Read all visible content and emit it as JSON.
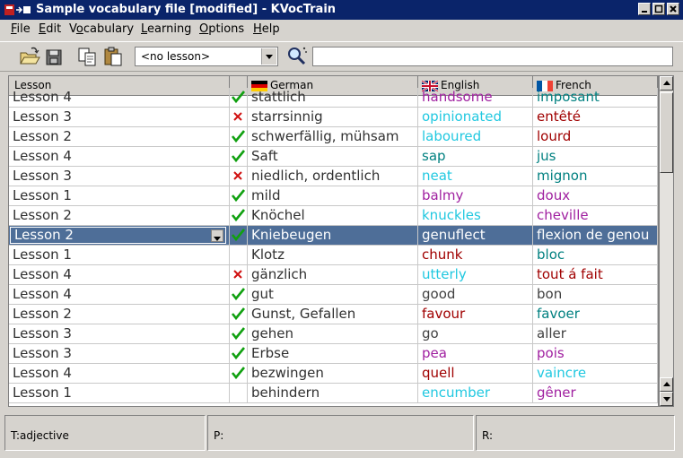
{
  "window": {
    "title": "Sample vocabulary file [modified] - KVocTrain"
  },
  "menu": [
    "File",
    "Edit",
    "Vocabulary",
    "Learning",
    "Options",
    "Help"
  ],
  "menu_mnemonic": [
    "F",
    "E",
    "o",
    "L",
    "O",
    "H"
  ],
  "toolbar": {
    "lesson_select": "<no lesson>",
    "search_value": ""
  },
  "table": {
    "headers": {
      "lesson": "Lesson",
      "german": "German",
      "english": "English",
      "french": "French"
    },
    "rows": [
      {
        "lesson": "Lesson 4",
        "mark": "check",
        "german": "stattlich",
        "english": "handsome",
        "french": "imposant",
        "ec": "#a020a0",
        "fc": "#008080"
      },
      {
        "lesson": "Lesson 3",
        "mark": "cross",
        "german": "starrsinnig",
        "english": "opinionated",
        "french": "entêté",
        "ec": "#20c8e0",
        "fc": "#a00000"
      },
      {
        "lesson": "Lesson 2",
        "mark": "check",
        "german": "schwerfällig, mühsam",
        "english": "laboured",
        "french": "lourd",
        "ec": "#20c8e0",
        "fc": "#a00000"
      },
      {
        "lesson": "Lesson 4",
        "mark": "check",
        "german": "Saft",
        "english": "sap",
        "french": "jus",
        "ec": "#008080",
        "fc": "#008080"
      },
      {
        "lesson": "Lesson 3",
        "mark": "cross",
        "german": "niedlich, ordentlich",
        "english": "neat",
        "french": "mignon",
        "ec": "#20c8e0",
        "fc": "#008080"
      },
      {
        "lesson": "Lesson 1",
        "mark": "check",
        "german": "mild",
        "english": "balmy",
        "french": "doux",
        "ec": "#a020a0",
        "fc": "#a020a0"
      },
      {
        "lesson": "Lesson 2",
        "mark": "check",
        "german": "Knöchel",
        "english": "knuckles",
        "french": "cheville",
        "ec": "#20c8e0",
        "fc": "#a020a0"
      },
      {
        "lesson": "Lesson 2",
        "mark": "check",
        "german": "Kniebeugen",
        "english": "genuflect",
        "french": "flexion de genou",
        "ec": "#ffffff",
        "fc": "#ffffff",
        "selected": true
      },
      {
        "lesson": "Lesson 1",
        "mark": "",
        "german": "Klotz",
        "english": "chunk",
        "french": "bloc",
        "ec": "#a00000",
        "fc": "#008080"
      },
      {
        "lesson": "Lesson 4",
        "mark": "cross",
        "german": "gänzlich",
        "english": "utterly",
        "french": "tout á fait",
        "ec": "#20c8e0",
        "fc": "#a00000"
      },
      {
        "lesson": "Lesson 4",
        "mark": "check",
        "german": "gut",
        "english": "good",
        "french": "bon",
        "ec": "#404040",
        "fc": "#404040"
      },
      {
        "lesson": "Lesson 2",
        "mark": "check",
        "german": "Gunst, Gefallen",
        "english": "favour",
        "french": "favoer",
        "ec": "#a00000",
        "fc": "#008080"
      },
      {
        "lesson": "Lesson 3",
        "mark": "check",
        "german": "gehen",
        "english": "go",
        "french": "aller",
        "ec": "#404040",
        "fc": "#404040"
      },
      {
        "lesson": "Lesson 3",
        "mark": "check",
        "german": "Erbse",
        "english": "pea",
        "french": "pois",
        "ec": "#a020a0",
        "fc": "#a020a0"
      },
      {
        "lesson": "Lesson 4",
        "mark": "check",
        "german": "bezwingen",
        "english": "quell",
        "french": "vaincre",
        "ec": "#a00000",
        "fc": "#20c8e0"
      },
      {
        "lesson": "Lesson 1",
        "mark": "",
        "german": "behindern",
        "english": "encumber",
        "french": "gêner",
        "ec": "#20c8e0",
        "fc": "#a020a0"
      }
    ]
  },
  "status": {
    "type": "T:adjective",
    "pron": "P:",
    "remark": "R:"
  },
  "icons": {
    "open": "folder-open-icon",
    "save": "save-disk-icon",
    "copy": "copy-icon",
    "paste": "paste-icon",
    "search": "search-icon",
    "check": "check-icon",
    "cross": "cross-icon"
  },
  "colors": {
    "titlebar": "#0a246a",
    "selection": "#4e6e98",
    "check": "#10a010",
    "cross": "#d01010"
  }
}
